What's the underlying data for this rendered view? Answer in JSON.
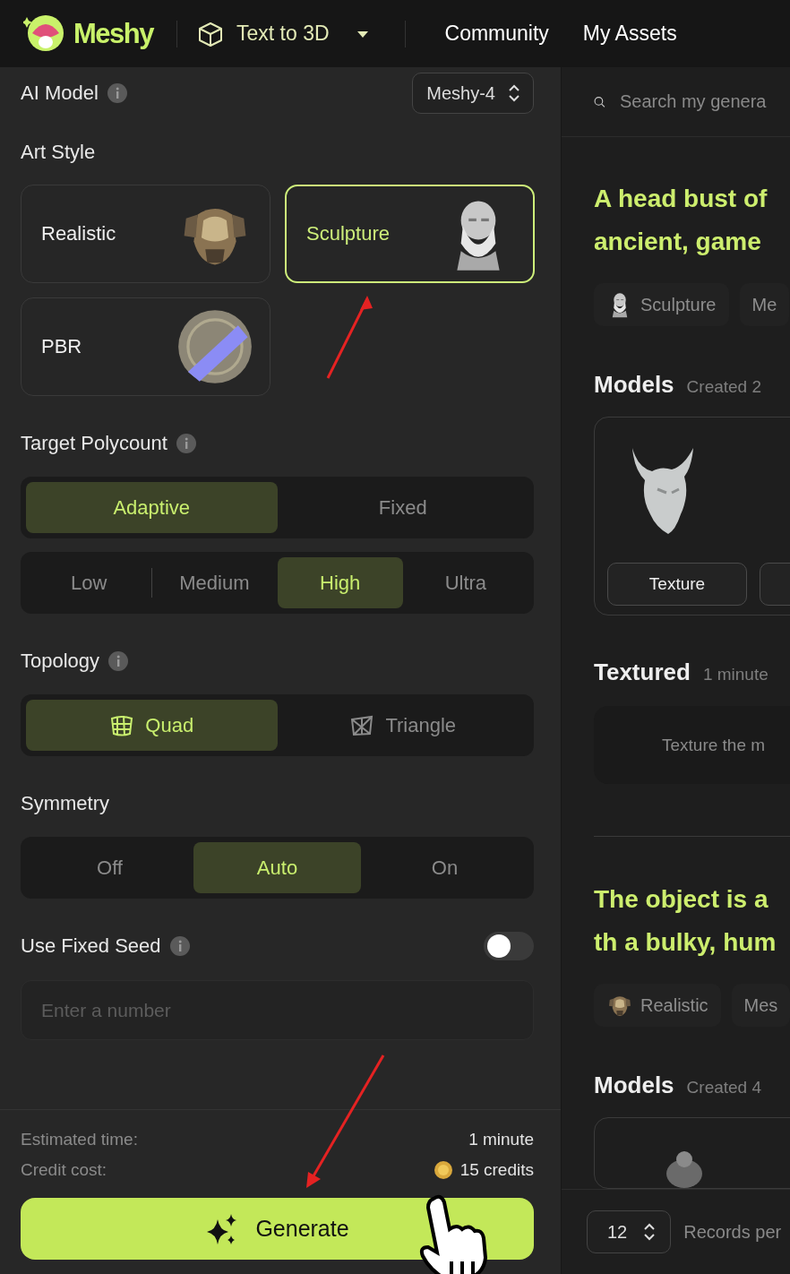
{
  "topbar": {
    "logo": "Meshy",
    "mode": "Text to 3D",
    "nav": [
      {
        "label": "Community"
      },
      {
        "label": "My Assets"
      }
    ]
  },
  "settings": {
    "ai_model": {
      "label": "AI Model",
      "value": "Meshy-4"
    },
    "art_style": {
      "label": "Art Style",
      "options": [
        {
          "label": "Realistic",
          "selected": false,
          "kind": "armor"
        },
        {
          "label": "Sculpture",
          "selected": true,
          "kind": "bust"
        },
        {
          "label": "PBR",
          "selected": false,
          "kind": "sphere"
        }
      ]
    },
    "polycount": {
      "label": "Target Polycount",
      "modes": [
        {
          "label": "Adaptive",
          "selected": true
        },
        {
          "label": "Fixed",
          "selected": false
        }
      ],
      "levels": [
        {
          "label": "Low",
          "selected": false
        },
        {
          "label": "Medium",
          "selected": false
        },
        {
          "label": "High",
          "selected": true
        },
        {
          "label": "Ultra",
          "selected": false
        }
      ]
    },
    "topology": {
      "label": "Topology",
      "options": [
        {
          "label": "Quad",
          "selected": true,
          "kind": "quad"
        },
        {
          "label": "Triangle",
          "selected": false,
          "kind": "triangle"
        }
      ]
    },
    "symmetry": {
      "label": "Symmetry",
      "options": [
        {
          "label": "Off",
          "selected": false
        },
        {
          "label": "Auto",
          "selected": true
        },
        {
          "label": "On",
          "selected": false
        }
      ]
    },
    "seed": {
      "label": "Use Fixed Seed",
      "on": false,
      "placeholder": "Enter a number"
    },
    "estimate": {
      "time_label": "Estimated time:",
      "time": "1 minute",
      "cost_label": "Credit cost:",
      "cost": "15 credits"
    },
    "generate": "Generate"
  },
  "feed": {
    "search": {
      "placeholder": "Search my genera"
    },
    "tasks": [
      {
        "prompt": "A head bust of ancient, game",
        "chips": [
          {
            "label": "Sculpture",
            "kind": "bust"
          },
          {
            "label": "Me",
            "kind": "plain"
          }
        ],
        "sections": [
          {
            "kind": "models",
            "title": "Models",
            "meta": "Created 2",
            "button": "Texture"
          },
          {
            "kind": "textured",
            "title": "Textured",
            "meta": "1 minute",
            "hint": "Texture the m"
          }
        ]
      },
      {
        "prompt": "The object is a th a bulky, hum",
        "chips": [
          {
            "label": "Realistic",
            "kind": "armor"
          },
          {
            "label": "Mes",
            "kind": "plain"
          }
        ],
        "sections": [
          {
            "kind": "models",
            "title": "Models",
            "meta": "Created 4"
          }
        ]
      }
    ],
    "pager": {
      "value": "12",
      "label": "Records per"
    }
  }
}
